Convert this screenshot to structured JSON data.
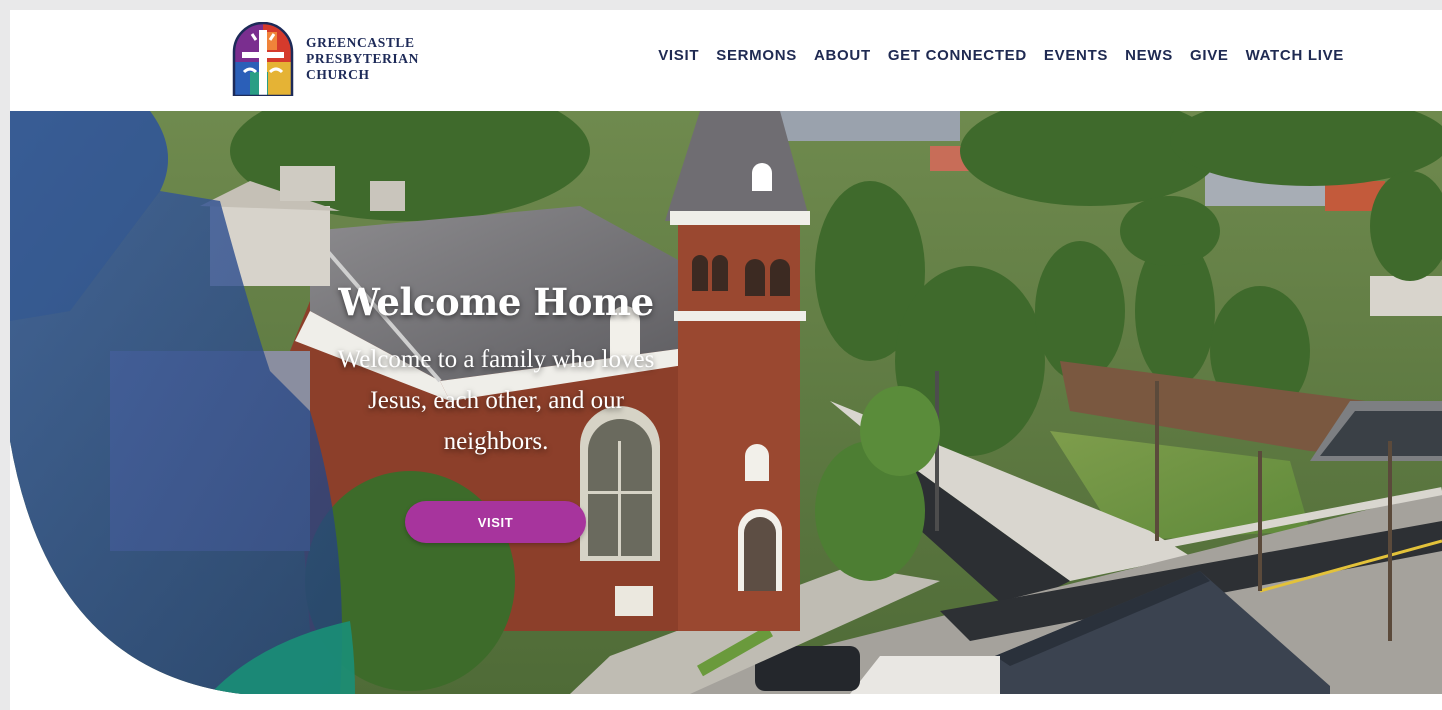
{
  "brand": {
    "name_lines": [
      "GREENCASTLE",
      "PRESBYTERIAN",
      "CHURCH"
    ],
    "logo_icon": "cross-window-logo-icon",
    "text_color": "#1d2a58"
  },
  "nav": {
    "items": [
      {
        "label": "VISIT"
      },
      {
        "label": "SERMONS"
      },
      {
        "label": "ABOUT"
      },
      {
        "label": "GET CONNECTED"
      },
      {
        "label": "EVENTS"
      },
      {
        "label": "NEWS"
      },
      {
        "label": "GIVE"
      },
      {
        "label": "WATCH LIVE"
      }
    ]
  },
  "hero": {
    "title": "Welcome Home",
    "subtitle": "Welcome to a family who loves Jesus, each other, and our neighbors.",
    "button_label": "VISIT",
    "image": "aerial-photo-brick-church-with-bell-tower-and-town-street"
  },
  "colors": {
    "accent": "#a7349d",
    "nav_text": "#1f2a52",
    "overlay_blue": "#2b4a8a",
    "overlay_green": "#1a8f77"
  }
}
